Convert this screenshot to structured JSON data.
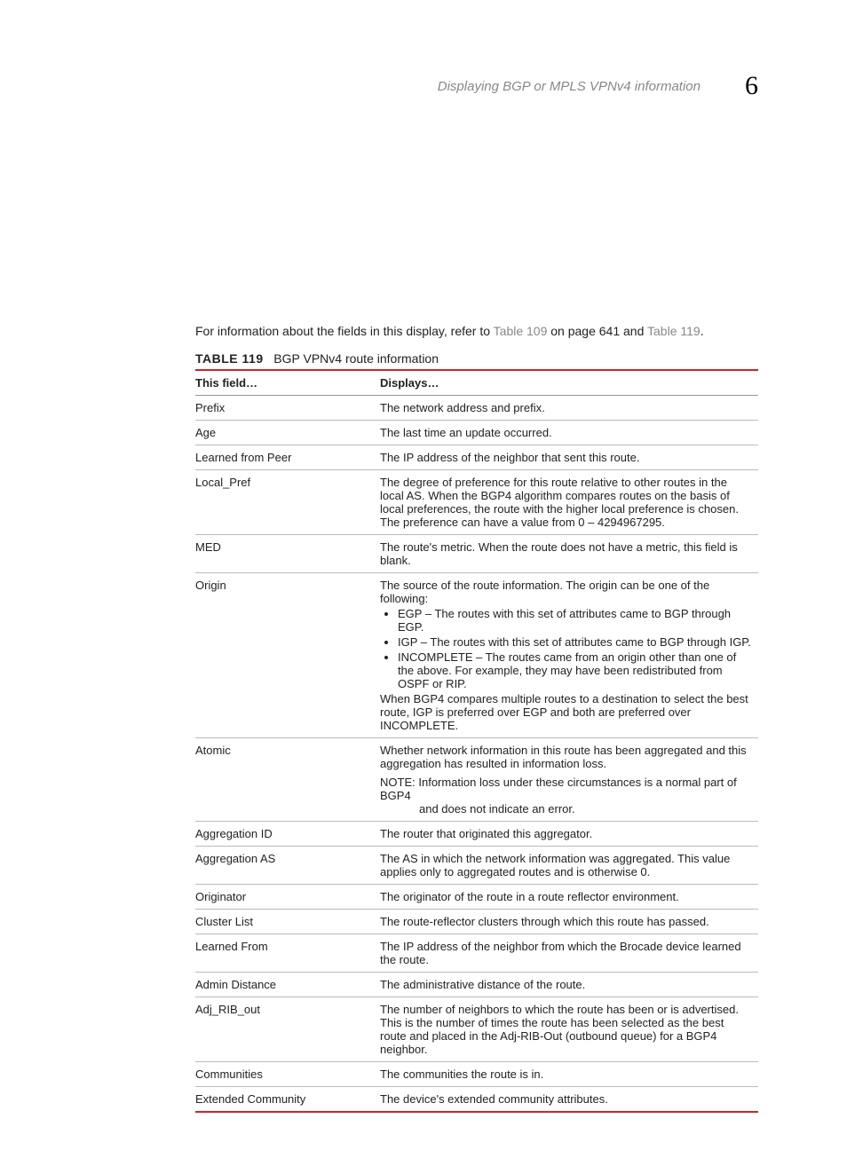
{
  "header": {
    "section": "Displaying BGP or MPLS VPNv4 information",
    "chapter": "6"
  },
  "intro": {
    "pre": "For information about the fields in this display, refer to ",
    "link1": "Table 109",
    "mid": " on page 641 and ",
    "link2": "Table 119",
    "post": "."
  },
  "tableCaption": {
    "label": "TABLE 119",
    "text": "BGP VPNv4 route information"
  },
  "tableHeader": {
    "field": "This field…",
    "displays": "Displays…"
  },
  "rows": {
    "prefix": {
      "field": "Prefix",
      "displays": "The network address and prefix."
    },
    "age": {
      "field": "Age",
      "displays": "The last time an update occurred."
    },
    "learnedPeer": {
      "field": "Learned from Peer",
      "displays": "The IP address of the neighbor that sent this route."
    },
    "localPref": {
      "field": "Local_Pref",
      "displays": "The degree of preference for this route relative to other routes in the local AS. When the BGP4 algorithm compares routes on the basis of local preferences, the route with the higher local preference is chosen. The preference can have a value from 0 – 4294967295."
    },
    "med": {
      "field": "MED",
      "displays": "The route's metric. When the route does not have a metric, this field is blank."
    },
    "origin": {
      "field": "Origin",
      "lead": "The source of the route information. The origin can be one of the following:",
      "items": {
        "egp": "EGP – The routes with this set of attributes came to BGP through EGP.",
        "igp": "IGP – The routes with this set of attributes came to BGP through IGP.",
        "incomplete": "INCOMPLETE – The routes came from an origin other than one of the above. For example, they may have been redistributed from OSPF or RIP."
      },
      "trail": "When BGP4 compares multiple routes to a destination to select the best route, IGP is preferred over EGP and both are preferred over INCOMPLETE."
    },
    "atomic": {
      "field": "Atomic",
      "line1": "Whether network information in this route has been aggregated and this aggregation has resulted in information loss.",
      "noteLabel": "NOTE:",
      "noteBody1": "Information loss under these circumstances is a normal part of BGP4",
      "noteBody2": "and does not indicate an error."
    },
    "aggId": {
      "field": "Aggregation ID",
      "displays": "The router that originated this aggregator."
    },
    "aggAs": {
      "field": "Aggregation AS",
      "displays": "The AS in which the network information was aggregated. This value applies only to aggregated routes and is otherwise 0."
    },
    "originator": {
      "field": "Originator",
      "displays": "The originator of the route in a route reflector environment."
    },
    "cluster": {
      "field": "Cluster List",
      "displays": "The route-reflector clusters through which this route has passed."
    },
    "learnedFrom": {
      "field": "Learned From",
      "displays": "The IP address of the neighbor from which the Brocade device learned the route."
    },
    "adminDist": {
      "field": "Admin Distance",
      "displays": "The administrative distance of the route."
    },
    "adjRibOut": {
      "field": "Adj_RIB_out",
      "displays": "The number of neighbors to which the route has been or is advertised. This is the number of times the route has been selected as the best route and placed in the Adj-RIB-Out (outbound queue) for a BGP4 neighbor."
    },
    "communities": {
      "field": "Communities",
      "displays": "The communities the route is in."
    },
    "extComm": {
      "field": "Extended Community",
      "displays": "The device's extended community attributes."
    }
  }
}
